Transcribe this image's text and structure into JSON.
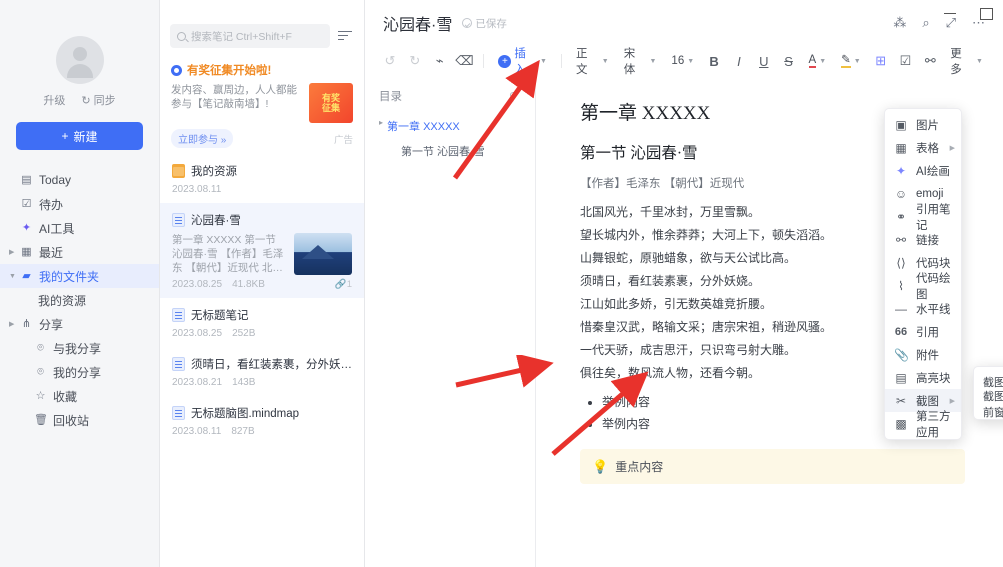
{
  "window": {
    "minimize": "–",
    "maximize": "□"
  },
  "sidebar": {
    "account": {
      "upgrade": "升级",
      "sync": "同步"
    },
    "new_button": "新建",
    "items": [
      {
        "label": "Today",
        "icon": "calendar-icon"
      },
      {
        "label": "待办",
        "icon": "checkbox-icon"
      },
      {
        "label": "AI工具",
        "icon": "ai-icon"
      },
      {
        "label": "最近",
        "icon": "clock-icon"
      },
      {
        "label": "我的文件夹",
        "icon": "folder-icon"
      },
      {
        "label": "我的资源",
        "icon": ""
      },
      {
        "label": "分享",
        "icon": "share-icon"
      },
      {
        "label": "与我分享",
        "icon": "user-share-icon"
      },
      {
        "label": "我的分享",
        "icon": "user-share-icon"
      },
      {
        "label": "收藏",
        "icon": "star-icon"
      },
      {
        "label": "回收站",
        "icon": "trash-icon"
      }
    ]
  },
  "filelist": {
    "search_placeholder": "搜索笔记 Ctrl+Shift+F",
    "ad": {
      "title": "有奖征集开始啦!",
      "body": "发内容、赢周边，人人都能参与【笔记敲南墙】!",
      "button": "立即参与 »",
      "tag": "广告",
      "thumb_text": "有奖\n征集"
    },
    "items": [
      {
        "icon": "folder-icon",
        "title": "我的资源",
        "date": "2023.08.11",
        "size": "",
        "snippet": "",
        "thumb": false,
        "selected": false,
        "attach": ""
      },
      {
        "icon": "doc-icon",
        "title": "沁园春·雪",
        "date": "2023.08.25",
        "size": "41.8KB",
        "snippet": "第一章 XXXXX 第一节 沁园春·雪 【作者】毛泽东 【朝代】近现代 北国风光，千里冰封，万里雪飘。",
        "thumb": true,
        "selected": true,
        "attach": "1"
      },
      {
        "icon": "doc-icon",
        "title": "无标题笔记",
        "date": "2023.08.25",
        "size": "252B",
        "snippet": "",
        "thumb": false,
        "selected": false,
        "attach": ""
      },
      {
        "icon": "doc-icon",
        "title": "须晴日，看红装素裹，分外妖娆。",
        "date": "2023.08.21",
        "size": "143B",
        "snippet": "",
        "thumb": false,
        "selected": false,
        "attach": ""
      },
      {
        "icon": "doc-icon",
        "title": "无标题脑图.mindmap",
        "date": "2023.08.11",
        "size": "827B",
        "snippet": "",
        "thumb": false,
        "selected": false,
        "attach": ""
      }
    ]
  },
  "editor": {
    "title": "沁园春·雪",
    "save_status": "已保存",
    "header_actions": [
      {
        "name": "share-icon",
        "glyph": "⁂"
      },
      {
        "name": "search-icon",
        "glyph": "⌕"
      },
      {
        "name": "collapse-icon",
        "glyph": "⤢"
      },
      {
        "name": "more-icon",
        "glyph": "⋯"
      }
    ],
    "toolbar": {
      "undo": "↺",
      "redo": "↻",
      "format_painter": "⌁",
      "clear_format": "⌫",
      "insert_label": "插入",
      "style_label": "正文",
      "font_label": "宋体",
      "size_label": "16",
      "bold": "B",
      "italic": "I",
      "underline": "U",
      "strike": "S",
      "text_color": "A",
      "highlight": "✎",
      "table": "⊞",
      "todo": "☑",
      "link": "🔗",
      "more_label": "更多"
    },
    "toc": {
      "header": "目录",
      "pin_icon": "pin-icon",
      "items": [
        {
          "label": "第一章 XXXXX",
          "level": 1
        },
        {
          "label": "第一节 沁园春·雪",
          "level": 2
        }
      ]
    },
    "document": {
      "h1": "第一章 XXXXX",
      "h2": "第一节 沁园春·雪",
      "meta": "【作者】毛泽东 【朝代】近现代",
      "lines": [
        "北国风光，千里冰封，万里雪飘。",
        "望长城内外，惟余莽莽；大河上下，顿失滔滔。",
        "山舞银蛇，原驰蜡象，欲与天公试比高。",
        "须晴日，看红装素裹，分外妖娆。",
        "江山如此多娇，引无数英雄竞折腰。",
        "惜秦皇汉武，略输文采；唐宗宋祖，稍逊风骚。",
        "一代天骄，成吉思汗，只识弯弓射大雕。",
        "俱往矣，数风流人物，还看今朝。"
      ],
      "bullets": [
        "举例内容",
        "举例内容"
      ],
      "callout": {
        "icon": "bulb-icon",
        "text": "重点内容"
      }
    },
    "insert_menu": {
      "items": [
        {
          "label": "图片",
          "icon": "image-icon",
          "glyph": "▣",
          "submenu": false,
          "highlight": false
        },
        {
          "label": "表格",
          "icon": "table-icon",
          "glyph": "▦",
          "submenu": true,
          "highlight": false
        },
        {
          "label": "AI绘画",
          "icon": "ai-paint-icon",
          "glyph": "✦",
          "submenu": false,
          "highlight": false
        },
        {
          "label": "emoji",
          "icon": "emoji-icon",
          "glyph": "☺",
          "submenu": false,
          "highlight": false
        },
        {
          "label": "引用笔记",
          "icon": "quote-note-icon",
          "glyph": "⚭",
          "submenu": false,
          "highlight": false
        },
        {
          "label": "链接",
          "icon": "link-icon",
          "glyph": "⚯",
          "submenu": false,
          "highlight": false
        },
        {
          "label": "代码块",
          "icon": "code-icon",
          "glyph": "⟨⟩",
          "submenu": false,
          "highlight": false
        },
        {
          "label": "代码绘图",
          "icon": "code-draw-icon",
          "glyph": "⌇",
          "submenu": false,
          "highlight": false
        },
        {
          "label": "水平线",
          "icon": "hr-icon",
          "glyph": "—",
          "submenu": false,
          "highlight": false
        },
        {
          "label": "引用",
          "icon": "quote-icon",
          "glyph": "66",
          "submenu": false,
          "highlight": false
        },
        {
          "label": "附件",
          "icon": "attachment-icon",
          "glyph": "📎",
          "submenu": false,
          "highlight": false
        },
        {
          "label": "高亮块",
          "icon": "highlight-block-icon",
          "glyph": "▤",
          "submenu": false,
          "highlight": false
        },
        {
          "label": "截图",
          "icon": "screenshot-icon",
          "glyph": "✂",
          "submenu": true,
          "highlight": true
        },
        {
          "label": "第三方应用",
          "icon": "apps-icon",
          "glyph": "▩",
          "submenu": false,
          "highlight": false
        }
      ]
    },
    "screenshot_submenu": {
      "items": [
        "截图",
        "截图并隐藏当前窗口"
      ]
    }
  },
  "annotations": {
    "arrow_color": "#e8322c",
    "cursor": "pointer-cursor"
  }
}
